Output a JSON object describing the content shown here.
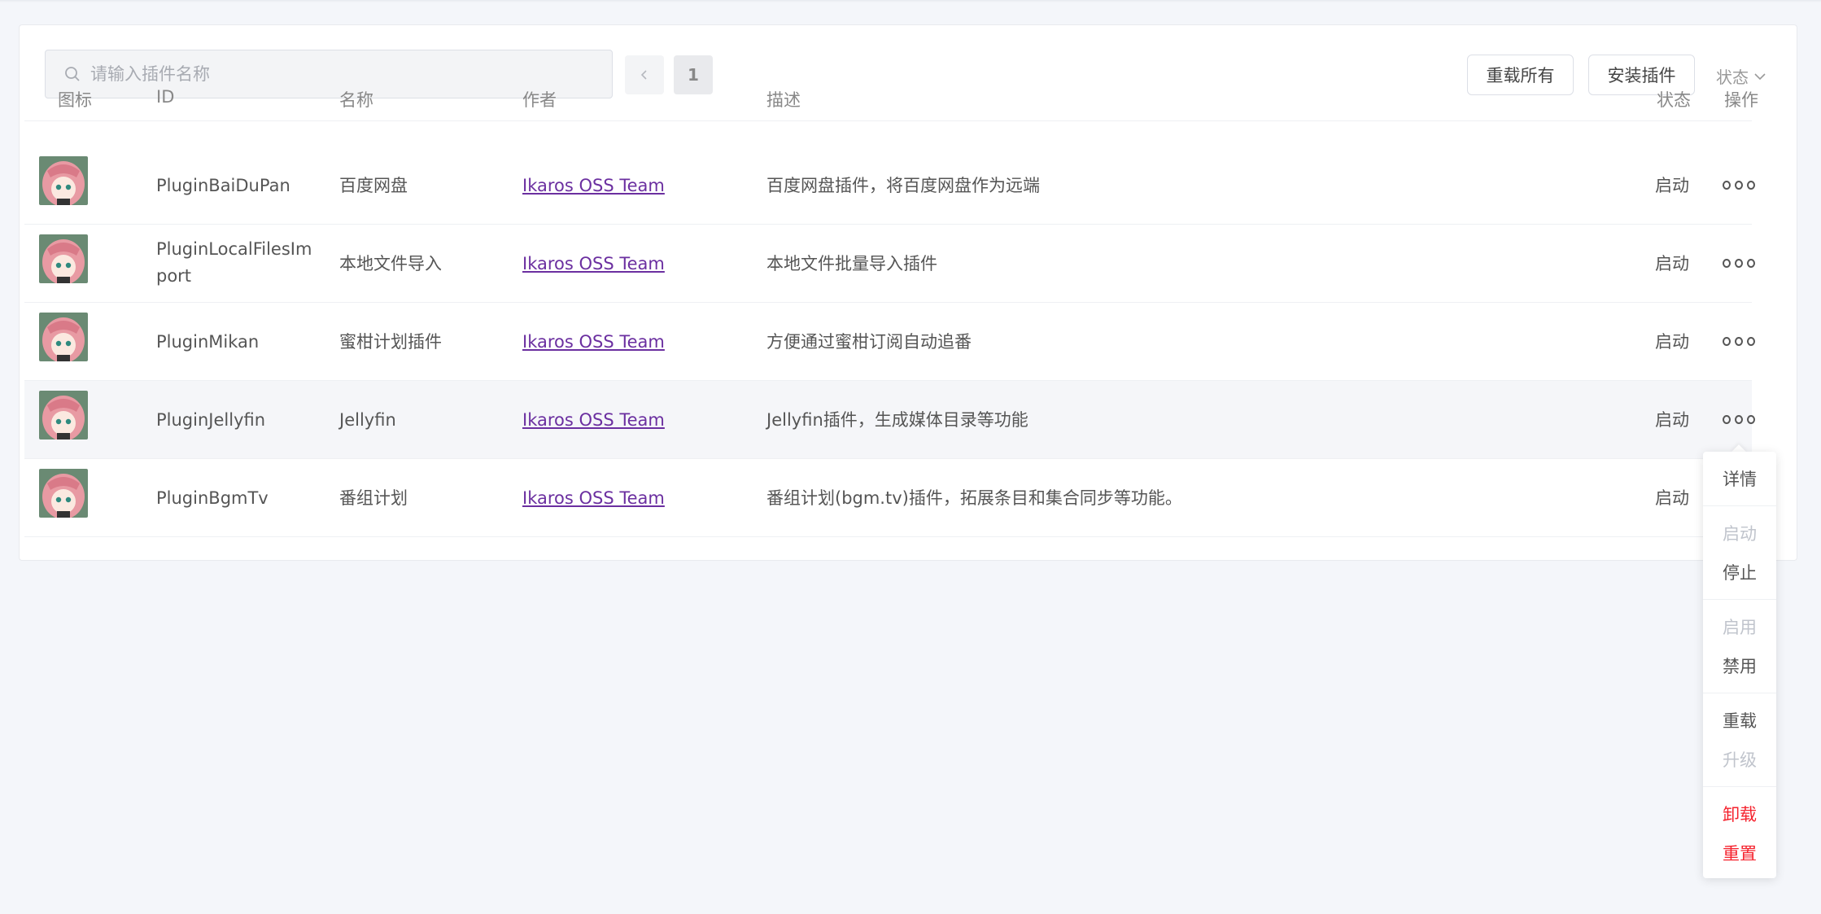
{
  "search": {
    "placeholder": "请输入插件名称"
  },
  "pagination": {
    "current": "1"
  },
  "toolbar": {
    "reload_all": "重载所有",
    "install": "安装插件",
    "status_filter": "状态"
  },
  "table": {
    "headers": {
      "icon": "图标",
      "id": "ID",
      "name": "名称",
      "author": "作者",
      "desc": "描述",
      "state": "状态",
      "ops": "操作"
    },
    "rows": [
      {
        "id": "PluginBaiDuPan",
        "name": "百度网盘",
        "author": "Ikaros OSS Team",
        "desc": "百度网盘插件，将百度网盘作为远端",
        "state": "启动"
      },
      {
        "id": "PluginLocalFilesImport",
        "name": "本地文件导入",
        "author": "Ikaros OSS Team",
        "desc": "本地文件批量导入插件",
        "state": "启动"
      },
      {
        "id": "PluginMikan",
        "name": "蜜柑计划插件",
        "author": "Ikaros OSS Team",
        "desc": "方便通过蜜柑订阅自动追番",
        "state": "启动"
      },
      {
        "id": "PluginJellyfin",
        "name": "Jellyfin",
        "author": "Ikaros OSS Team",
        "desc": "Jellyfin插件，生成媒体目录等功能",
        "state": "启动"
      },
      {
        "id": "PluginBgmTv",
        "name": "番组计划",
        "author": "Ikaros OSS Team",
        "desc": "番组计划(bgm.tv)插件，拓展条目和集合同步等功能。",
        "state": "启动"
      }
    ]
  },
  "dropdown": {
    "details": "详情",
    "start": "启动",
    "stop": "停止",
    "enable": "启用",
    "disable": "禁用",
    "reload": "重载",
    "upgrade": "升级",
    "uninstall": "卸载",
    "reset": "重置"
  },
  "colors": {
    "author_link": "#6b2fa0",
    "danger": "#f5222d",
    "background": "#f4f6fa"
  }
}
